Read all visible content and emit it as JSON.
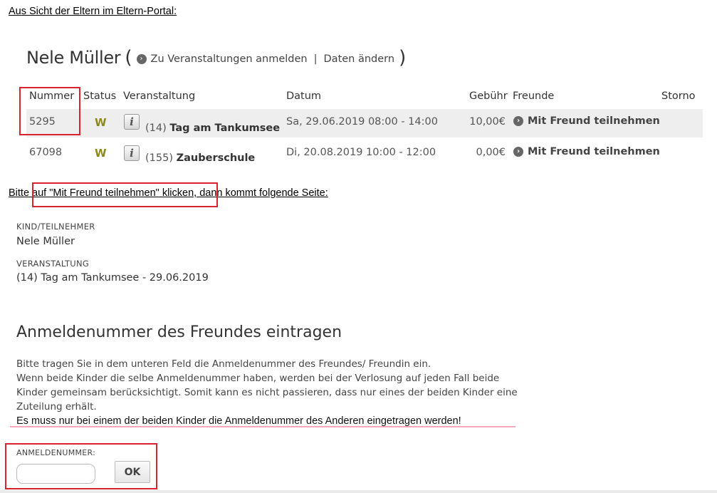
{
  "captions": {
    "top": "Aus Sicht der Eltern im Eltern-Portal:",
    "middle": "Bitte auf \"Mit Freund teilnehmen\" klicken, dann kommt folgende Seite:"
  },
  "header": {
    "child_name": "Nele Müller",
    "paren_open": "(",
    "paren_close": ")",
    "link_register": "Zu Veranstaltungen anmelden",
    "separator": "|",
    "link_edit": "Daten ändern"
  },
  "table": {
    "columns": {
      "number": "Nummer",
      "status": "Status",
      "event": "Veranstaltung",
      "date": "Datum",
      "fee": "Gebühr",
      "friends": "Freunde",
      "cancel": "Storno"
    },
    "rows": [
      {
        "number": "5295",
        "status": "W",
        "event_number": "(14)",
        "event_name": "Tag am Tankumsee",
        "date": "Sa, 29.06.2019 08:00 - 14:00",
        "fee": "10,00€",
        "friend_action": "Mit Freund teilnehmen"
      },
      {
        "number": "67098",
        "status": "W",
        "event_number": "(155)",
        "event_name": "Zauberschule",
        "date": "Di, 20.08.2019 10:00 - 12:00",
        "fee": "0,00€",
        "friend_action": "Mit Freund teilnehmen"
      }
    ]
  },
  "detail": {
    "child_label": "KIND/TEILNEHMER",
    "child_value": "Nele Müller",
    "event_label": "VERANSTALTUNG",
    "event_value": "(14) Tag am Tankumsee - 29.06.2019"
  },
  "friend_section": {
    "heading": "Anmeldenummer des Freundes eintragen",
    "line1": "Bitte tragen Sie in dem unteren Feld die Anmeldenummer des Freundes/ Freundin ein.",
    "line2": "Wenn beide Kinder die selbe Anmeldenummer haben, werden bei der Verlosung auf jeden Fall beide Kinder gemeinsam berücksichtigt. Somit kann es nicht passieren, dass nur eines der beiden Kinder eine Zuteilung erhält.",
    "note": "Es muss nur bei einem der beiden Kinder die Anmeldenummer des Anderen eingetragen werden!",
    "field_label": "ANMELDENUMMER:",
    "field_value": "",
    "ok_label": "OK"
  },
  "colors": {
    "highlight_border": "#d9232e",
    "note_underline": "#f4a7bd",
    "status_color": "#8a8a1a",
    "row_highlight": "#eeeeee"
  }
}
